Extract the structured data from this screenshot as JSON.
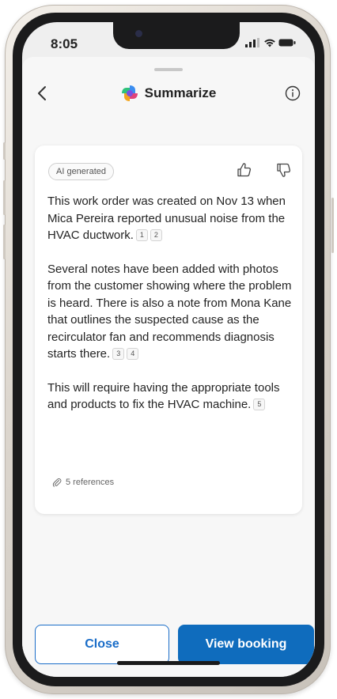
{
  "status_bar": {
    "time": "8:05"
  },
  "nav": {
    "title": "Summarize",
    "back_icon": "chevron-left-icon",
    "info_icon": "info-icon",
    "brand_icon": "copilot-icon"
  },
  "card": {
    "badge": "AI generated",
    "paragraphs": [
      {
        "text": "This work order was created on Nov 13 when Mica Pereira reported unusual noise from the HVAC ductwork.",
        "refs": [
          "1",
          "2"
        ]
      },
      {
        "text": "Several notes have been added with photos from the customer showing where the problem is heard. There is also a note from Mona Kane that outlines the suspected cause as the recirculator fan and recommends diagnosis starts there.",
        "refs": [
          "3",
          "4"
        ]
      },
      {
        "text": "This will require having the appropriate tools and products to fix the HVAC machine.",
        "refs": [
          "5"
        ]
      }
    ],
    "references_label": "5 references"
  },
  "actions": {
    "close_label": "Close",
    "view_label": "View booking"
  },
  "colors": {
    "accent": "#0f6cbd",
    "outline": "#1a6dc8",
    "sheet_bg": "#f7f7f7"
  }
}
